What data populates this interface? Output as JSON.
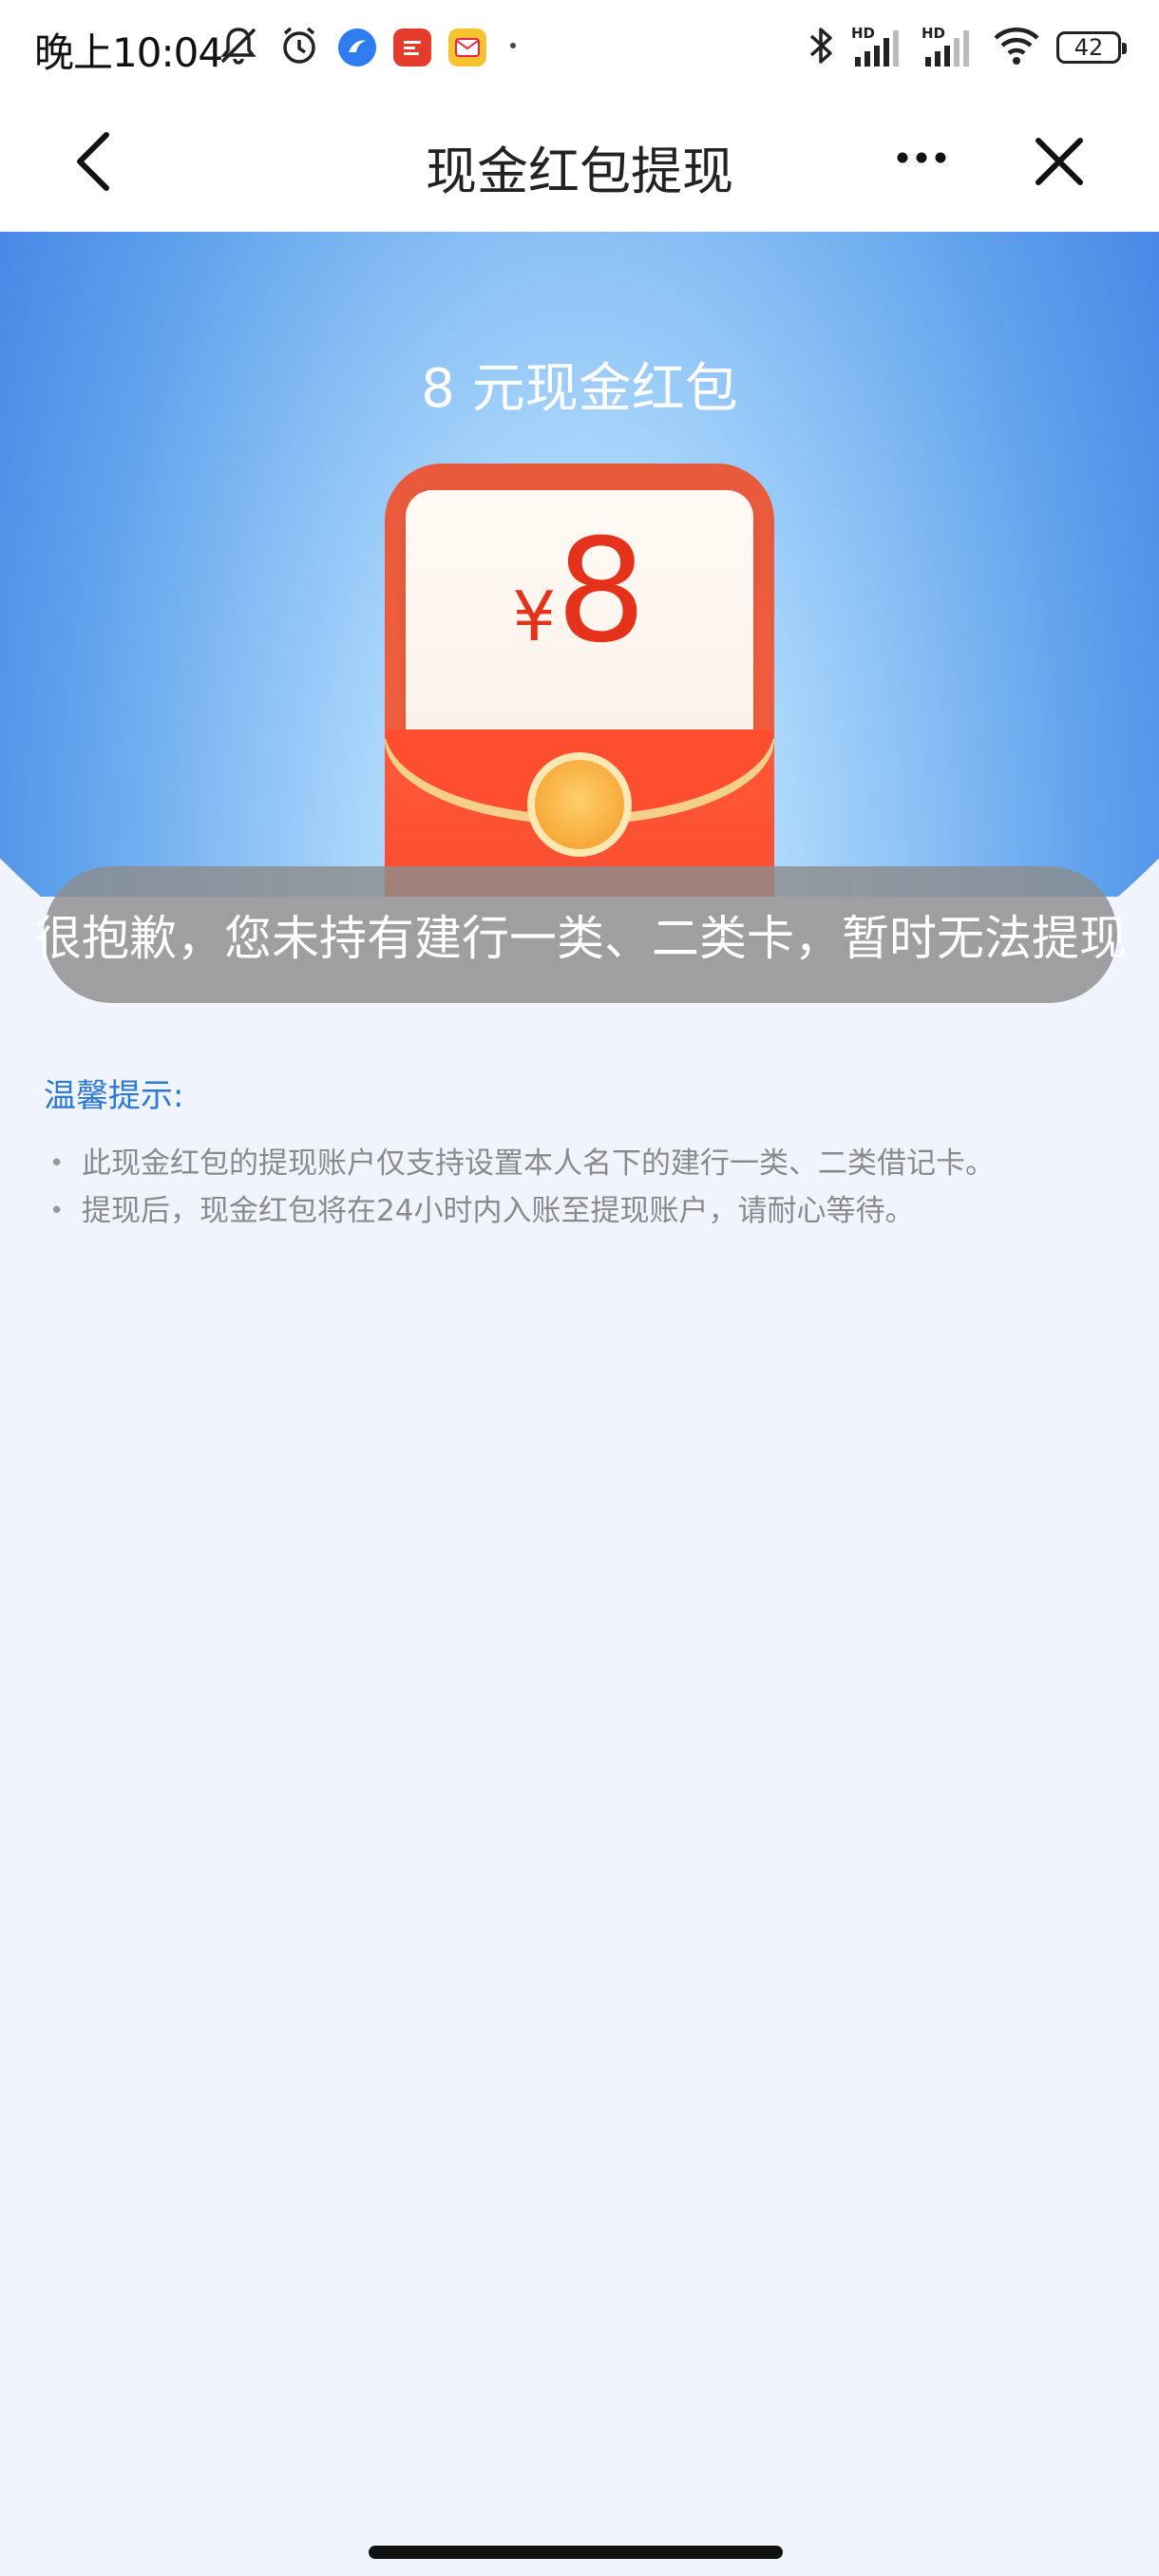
{
  "status_bar": {
    "time": "晚上10:04",
    "left_icons": [
      "muted-bell-icon",
      "alarm-icon",
      "browser-app-icon",
      "news-app-icon",
      "mail-app-icon",
      "more-dot-icon"
    ],
    "right_icons": [
      "bluetooth-icon",
      "signal-hd-icon",
      "signal-hd-icon",
      "wifi-icon"
    ],
    "signal_label_1": "HD",
    "signal_label_2": "HD",
    "battery": "42"
  },
  "navbar": {
    "title": "现金红包提现",
    "back_icon": "chevron-left-icon",
    "more_icon": "more-horizontal-icon",
    "close_icon": "close-icon"
  },
  "hero": {
    "title": "8 元现金红包",
    "currency": "¥",
    "amount": "8"
  },
  "toast": {
    "message": "很抱歉，您未持有建行一类、二类卡，暂时无法提现"
  },
  "tips": {
    "title": "温馨提示:",
    "items": [
      "此现金红包的提现账户仅支持设置本人名下的建行一类、二类借记卡。",
      "提现后，现金红包将在24小时内入账至提现账户，请耐心等待。"
    ]
  },
  "colors": {
    "accent_blue": "#2e78d8",
    "envelope_red": "#f23a22",
    "background": "#f0f4fd"
  }
}
